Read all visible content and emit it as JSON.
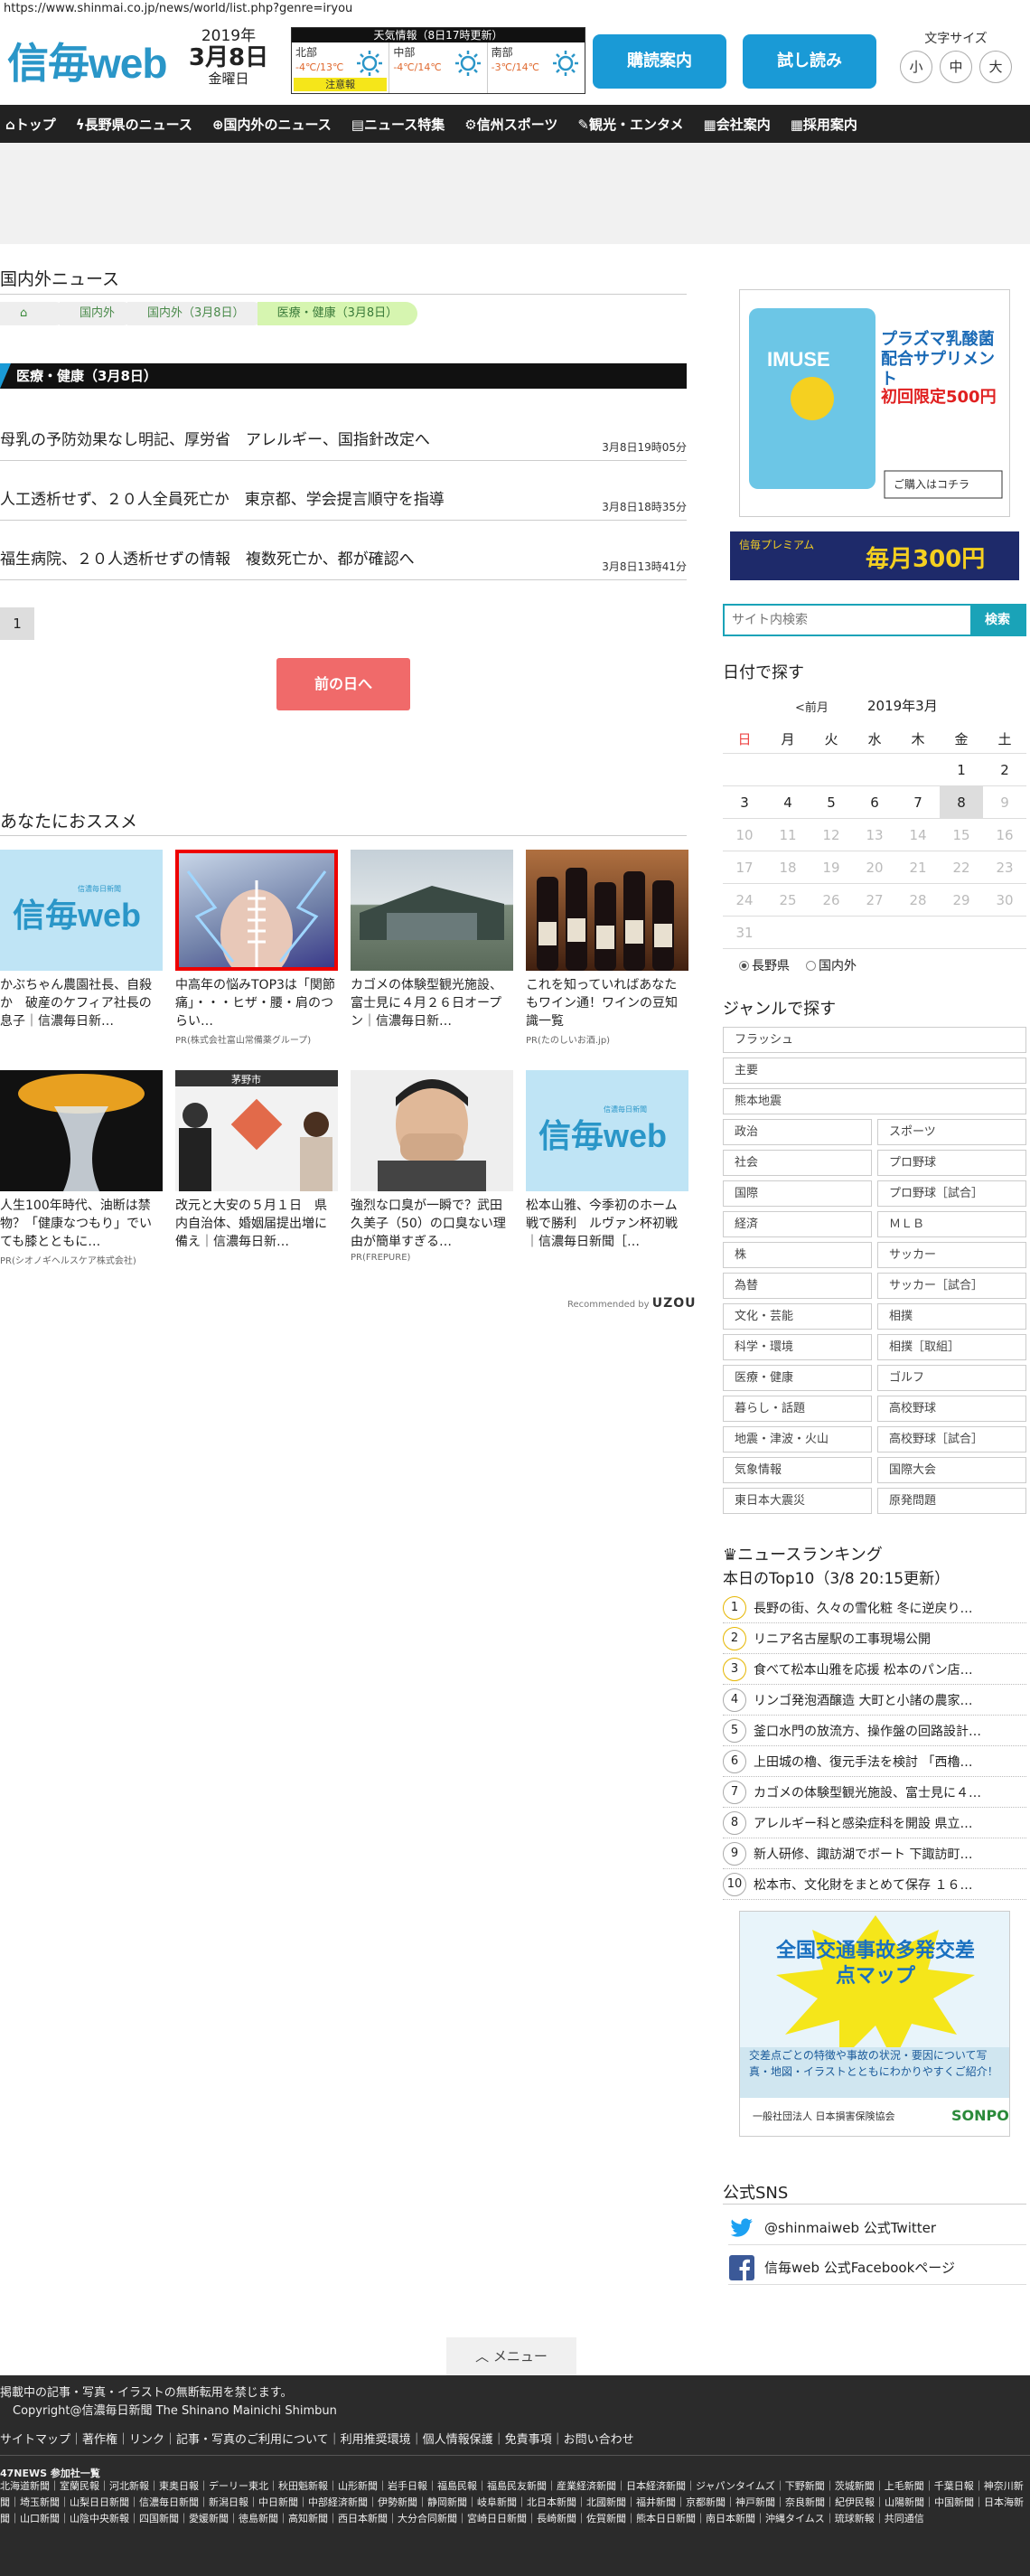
{
  "url": "https://www.shinmai.co.jp/news/world/list.php?genre=iryou",
  "header": {
    "logo": "信毎web",
    "date_year": "2019年",
    "date_day": "3月8日",
    "date_week": "金曜日",
    "weather_head": "天気情報（8日17時更新）",
    "weather": [
      {
        "name": "北部",
        "temp": "-4℃/13℃",
        "warning": "注意報"
      },
      {
        "name": "中部",
        "temp": "-4℃/14℃",
        "warning": ""
      },
      {
        "name": "南部",
        "temp": "-3℃/14℃",
        "warning": ""
      }
    ],
    "btn_subscribe": "購読案内",
    "btn_trial": "試し読み",
    "font_size_label": "文字サイズ",
    "font_sizes": [
      "小",
      "中",
      "大"
    ]
  },
  "nav": [
    {
      "icon": "home-icon",
      "label": "トップ"
    },
    {
      "icon": "lightning-icon",
      "label": "長野県のニュース"
    },
    {
      "icon": "globe-icon",
      "label": "国内外のニュース"
    },
    {
      "icon": "document-icon",
      "label": "ニュース特集"
    },
    {
      "icon": "bike-icon",
      "label": "信州スポーツ"
    },
    {
      "icon": "pen-icon",
      "label": "観光・エンタメ"
    },
    {
      "icon": "building-icon",
      "label": "会社案内"
    },
    {
      "icon": "building-icon",
      "label": "採用案内"
    }
  ],
  "main": {
    "section_title": "国内外ニュース",
    "breadcrumbs": [
      "国内外",
      "国内外（3月8日）",
      "医療・健康（3月8日）"
    ],
    "genre_bar": "医療・健康（3月8日）",
    "news": [
      {
        "title": "母乳の予防効果なし明記、厚労省　アレルギー、国指針改定へ",
        "time": "3月8日19時05分"
      },
      {
        "title": "人工透析せず、２０人全員死亡か　東京都、学会提言順守を指導",
        "time": "3月8日18時35分"
      },
      {
        "title": "福生病院、２０人透析せずの情報　複数死亡か、都が確認へ",
        "time": "3月8日13時41分"
      }
    ],
    "page_number": "1",
    "prev_day": "前の日へ",
    "rec_title": "あなたにおススメ",
    "cards": [
      {
        "text": "かぶちゃん農園社長、自殺か　破産のケフィア社長の息子｜信濃毎日新…",
        "pr": "",
        "img": "logo"
      },
      {
        "text": "中高年の悩みTOP3は「関節痛」・・・ヒザ・腰・肩のつらい…",
        "pr": "PR(株式会社富山常備薬グループ)",
        "img": "back"
      },
      {
        "text": "カゴメの体験型観光施設、富士見に４月２６日オープン｜信濃毎日新…",
        "pr": "",
        "img": "building"
      },
      {
        "text": "これを知っていればあなたもワイン通！ワインの豆知識一覧",
        "pr": "PR(たのしいお酒.jp)",
        "img": "wine"
      },
      {
        "text": "人生100年時代、油断は禁物？「健康なつもり」でいても膝とともに…",
        "pr": "PR(シオノギヘルスケア株式会社)",
        "img": "splash"
      },
      {
        "text": "改元と大安の５月１日　県内自治体、婚姻届提出増に備え｜信濃毎日新…",
        "pr": "",
        "img": "people"
      },
      {
        "text": "強烈な口臭が一瞬で？武田久美子（50）の口臭ない理由が簡単すぎる…",
        "pr": "PR(FREPURE)",
        "img": "man"
      },
      {
        "text": "松本山雅、今季初のホーム戦で勝利　ルヴァン杯初戦｜信濃毎日新聞［…",
        "pr": "",
        "img": "logo"
      }
    ],
    "people_sign": "茅野市",
    "recommended_by": "Recommended by",
    "recommended_brand": "UZOU",
    "card_logo": "信毎web",
    "card_logo_sub": "信濃毎日新聞"
  },
  "sidebar": {
    "ad1_text": "プラズマ乳酸菌配合サプリメント",
    "ad1_price": "初回限定500円",
    "ad1_brand": "IMUSE",
    "ad1_cta": "ご購入はコチラ",
    "ad2_text": "毎月300円",
    "ad2_sub": "信毎プレミアム",
    "search_placeholder": "サイト内検索",
    "search_btn": "検索",
    "cal_title": "日付で探す",
    "cal_prev": "<前月",
    "cal_month": "2019年3月",
    "cal_weekdays": [
      "日",
      "月",
      "火",
      "水",
      "木",
      "金",
      "土"
    ],
    "cal_weeks": [
      [
        "",
        "",
        "",
        "",
        "",
        "1",
        "2"
      ],
      [
        "3",
        "4",
        "5",
        "6",
        "7",
        "8",
        "9"
      ],
      [
        "10",
        "11",
        "12",
        "13",
        "14",
        "15",
        "16"
      ],
      [
        "17",
        "18",
        "19",
        "20",
        "21",
        "22",
        "23"
      ],
      [
        "24",
        "25",
        "26",
        "27",
        "28",
        "29",
        "30"
      ],
      [
        "31",
        "",
        "",
        "",
        "",
        "",
        ""
      ]
    ],
    "cal_today": "8",
    "cal_radio": [
      "長野県",
      "国内外"
    ],
    "genre_title": "ジャンルで探す",
    "genres_single": [
      "フラッシュ",
      "主要",
      "熊本地震"
    ],
    "genres_pairs": [
      [
        "政治",
        "スポーツ"
      ],
      [
        "社会",
        "プロ野球"
      ],
      [
        "国際",
        "プロ野球［試合］"
      ],
      [
        "経済",
        "ＭＬＢ"
      ],
      [
        "株",
        "サッカー"
      ],
      [
        "為替",
        "サッカー［試合］"
      ],
      [
        "文化・芸能",
        "相撲"
      ],
      [
        "科学・環境",
        "相撲［取組］"
      ],
      [
        "医療・健康",
        "ゴルフ"
      ],
      [
        "暮らし・話題",
        "高校野球"
      ],
      [
        "地震・津波・火山",
        "高校野球［試合］"
      ],
      [
        "気象情報",
        "国際大会"
      ],
      [
        "東日本大震災",
        "原発問題"
      ]
    ],
    "ranking_title": "ニュースランキング",
    "ranking_sub": "本日のTop10（3/8 20:15更新）",
    "ranking": [
      "長野の街、久々の雪化粧 冬に逆戻り…",
      "リニア名古屋駅の工事現場公開",
      "食べて松本山雅を応援 松本のパン店…",
      "リンゴ発泡酒醸造 大町と小諸の農家…",
      "釜口水門の放流方、操作盤の回路設計…",
      "上田城の櫓、復元手法を検討 「西櫓…",
      "カゴメの体験型観光施設、富士見に４…",
      "アレルギー科と感染症科を開設 県立…",
      "新人研修、諏訪湖でボート 下諏訪町…",
      "松本市、文化財をまとめて保存 １６…"
    ],
    "ad3_title": "全国交通事故多発交差点マップ",
    "ad3_text": "交差点ごとの特徴や事故の状況・要因について写真・地図・イラストとともにわかりやすくご紹介！",
    "ad3_org": "一般社団法人 日本損害保険協会",
    "ad3_brand": "SONPO",
    "sns_title": "公式SNS",
    "sns": [
      "@shinmaiweb 公式Twitter",
      "信毎web 公式Facebookページ"
    ]
  },
  "menu_btn": "メニュー",
  "footer": {
    "notice": "掲載中の記事・写真・イラストの無断転用を禁じます。",
    "copyright": "Copyright@信濃毎日新聞 The Shinano Mainichi Shimbun",
    "links": "サイトマップ｜著作権｜リンク｜記事・写真のご利用について｜利用推奨環境｜個人情報保護｜免責事項｜お問い合わせ",
    "news47": "47NEWS 参加社一覧",
    "papers": "北海道新聞｜室蘭民報｜河北新報｜東奥日報｜デーリー東北｜秋田魁新報｜山形新聞｜岩手日報｜福島民報｜福島民友新聞｜産業経済新聞｜日本経済新聞｜ジャパンタイムズ｜下野新聞｜茨城新聞｜上毛新聞｜千葉日報｜神奈川新聞｜埼玉新聞｜山梨日日新聞｜信濃毎日新聞｜新潟日報｜中日新聞｜中部経済新聞｜伊勢新聞｜静岡新聞｜岐阜新聞｜北日本新聞｜北國新聞｜福井新聞｜京都新聞｜神戸新聞｜奈良新聞｜紀伊民報｜山陽新聞｜中国新聞｜日本海新聞｜山口新聞｜山陰中央新報｜四国新聞｜愛媛新聞｜徳島新聞｜高知新聞｜西日本新聞｜大分合同新聞｜宮崎日日新聞｜長崎新聞｜佐賀新聞｜熊本日日新聞｜南日本新聞｜沖縄タイムス｜琉球新報｜共同通信"
  },
  "colors": {
    "brand": "#2a96c8",
    "nav": "#222222",
    "accent_button": "#1a9ad6",
    "prev_day": "#f06a6a",
    "search": "#1aa3b8"
  }
}
